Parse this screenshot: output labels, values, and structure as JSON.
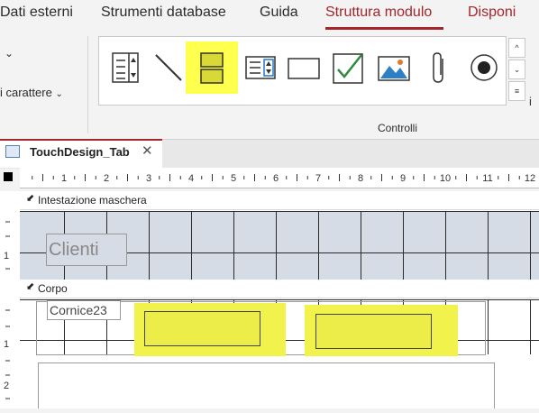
{
  "ribbon": {
    "tabs": [
      {
        "label": "Dati esterni"
      },
      {
        "label": "Strumenti database"
      },
      {
        "label": "Guida"
      },
      {
        "label": "Struttura modulo",
        "active": true
      },
      {
        "label": "Disponi"
      }
    ],
    "partial_group_label": "i carattere",
    "controls_group_label": "Controlli",
    "right_edge_letter": "i",
    "controls": [
      {
        "icon": "listbox-icon"
      },
      {
        "icon": "line-icon"
      },
      {
        "icon": "page-break-icon",
        "highlighted": true
      },
      {
        "icon": "combobox-icon"
      },
      {
        "icon": "rectangle-icon"
      },
      {
        "icon": "checkbox-icon"
      },
      {
        "icon": "image-icon"
      },
      {
        "icon": "attachment-icon"
      },
      {
        "icon": "option-button-icon"
      }
    ]
  },
  "document": {
    "tab_title": "TouchDesign_Tab"
  },
  "ruler": {
    "h_labels": [
      "1",
      "2",
      "3",
      "4",
      "5",
      "6",
      "7",
      "8",
      "9",
      "10",
      "11",
      "12"
    ],
    "v_header_labels": [
      "1"
    ],
    "v_body_labels": [
      "1",
      "2"
    ]
  },
  "sections": {
    "header_label": "Intestazione maschera",
    "body_label": "Corpo"
  },
  "controls_on_form": {
    "header_title": "Clienti",
    "frame_label": "Cornice23"
  },
  "colors": {
    "accent": "#a4262c",
    "highlight": "#ffff4d",
    "header_section_bg": "#d6dce5"
  }
}
